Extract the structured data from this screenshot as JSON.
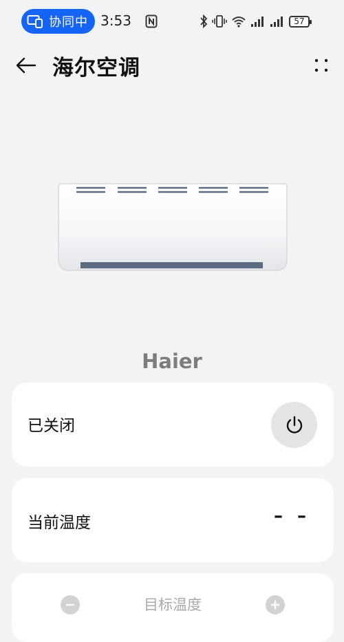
{
  "status_bar": {
    "collab_label": "协同中",
    "time": "3:53",
    "battery_level": "57"
  },
  "header": {
    "title": "海尔空调"
  },
  "device": {
    "brand": "Haier"
  },
  "power_card": {
    "status_label": "已关闭",
    "power_state": "off"
  },
  "temperature_card": {
    "label": "当前温度",
    "value": "– –"
  },
  "target_card": {
    "label": "目标温度",
    "enabled": false
  },
  "colors": {
    "background": "#f1f3f5",
    "accent": "#1664f5",
    "card": "#ffffff",
    "ac_vent": "#5a6a80"
  }
}
